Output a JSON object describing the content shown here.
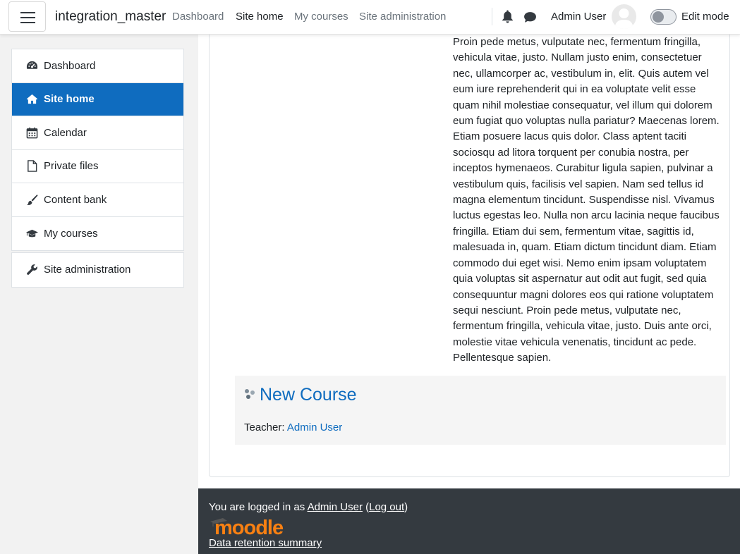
{
  "navbar": {
    "site_name": "integration_master",
    "links": [
      "Dashboard",
      "Site home",
      "My courses",
      "Site administration"
    ],
    "active_link": "Site home",
    "user_name": "Admin User",
    "edit_mode_label": "Edit mode",
    "edit_mode_on": false
  },
  "drawer": {
    "items": [
      {
        "label": "Dashboard",
        "icon": "tachometer-icon"
      },
      {
        "label": "Site home",
        "icon": "home-icon",
        "active": true
      },
      {
        "label": "Calendar",
        "icon": "calendar-icon"
      },
      {
        "label": "Private files",
        "icon": "file-icon"
      },
      {
        "label": "Content bank",
        "icon": "paintbrush-icon"
      },
      {
        "label": "My courses",
        "icon": "graduation-cap-icon"
      }
    ],
    "admin_item": {
      "label": "Site administration",
      "icon": "wrench-icon"
    }
  },
  "main": {
    "body_text": "Proin pede metus, vulputate nec, fermentum fringilla, vehicula vitae, justo. Nullam justo enim, consectetuer nec, ullamcorper ac, vestibulum in, elit. Quis autem vel eum iure reprehenderit qui in ea voluptate velit esse quam nihil molestiae consequatur, vel illum qui dolorem eum fugiat quo voluptas nulla pariatur? Maecenas lorem. Etiam posuere lacus quis dolor. Class aptent taciti sociosqu ad litora torquent per conubia nostra, per inceptos hymenaeos. Curabitur ligula sapien, pulvinar a vestibulum quis, facilisis vel sapien. Nam sed tellus id magna elementum tincidunt. Suspendisse nisl. Vivamus luctus egestas leo. Nulla non arcu lacinia neque faucibus fringilla. Etiam dui sem, fermentum vitae, sagittis id, malesuada in, quam. Etiam dictum tincidunt diam. Etiam commodo dui eget wisi. Nemo enim ipsam voluptatem quia voluptas sit aspernatur aut odit aut fugit, sed quia consequuntur magni dolores eos qui ratione voluptatem sequi nesciunt. Proin pede metus, vulputate nec, fermentum fringilla, vehicula vitae, justo. Duis ante orci, molestie vitae vehicula venenatis, tincidunt ac pede. Pellentesque sapien.",
    "course": {
      "title": "New Course",
      "teacher_label": "Teacher:",
      "teacher_name": "Admin User"
    }
  },
  "footer": {
    "logged_in_prefix": "You are logged in as",
    "logged_in_user": "Admin User",
    "logout_label": "Log out",
    "logo_text": "moodle",
    "data_retention_label": "Data retention summary"
  },
  "colors": {
    "accent": "#0f6cbf",
    "footer_bg": "#343a40",
    "moodle_orange": "#f98012"
  }
}
